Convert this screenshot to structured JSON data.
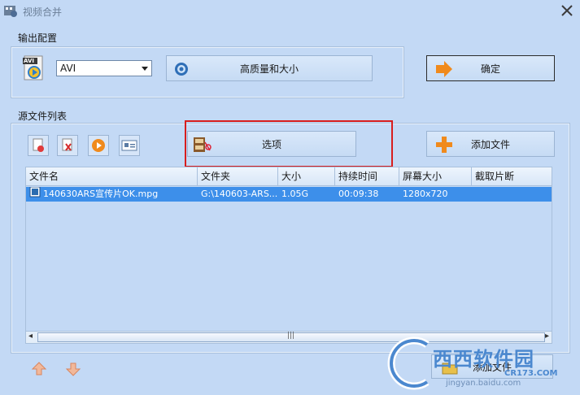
{
  "window": {
    "title": "视频合并"
  },
  "output_config": {
    "label": "输出配置",
    "format_value": "AVI",
    "format_badge": "AVI",
    "quality_button": "高质量和大小",
    "ok_button": "确定"
  },
  "source_files": {
    "label": "源文件列表",
    "options_button": "选项",
    "add_file_button": "添加文件",
    "columns": [
      "文件名",
      "文件夹",
      "大小",
      "持续时间",
      "屏幕大小",
      "截取片断"
    ],
    "rows": [
      {
        "name": "140630ARS宣传片OK.mpg",
        "folder": "G:\\140603-ARS...",
        "size": "1.05G",
        "duration": "00:09:38",
        "screen": "1280x720",
        "clip": ""
      }
    ]
  },
  "scrollbar": {
    "left_arrow": "◂",
    "right_arrow": "▸",
    "grip": "|||"
  },
  "bottom": {
    "partial_button_text": "添加文件"
  },
  "watermark": {
    "line1": "西西软件园",
    "line2": "jingyan.baidu.com",
    "line3": "CR173.COM"
  },
  "colors": {
    "window_bg": "#c3d9f5",
    "selection": "#3d8fea",
    "highlight_box": "#d81e1e",
    "accent_orange": "#f08a1c"
  },
  "icons": {
    "title": "video-merge-icon",
    "close": "close-icon",
    "avi": "avi-file-icon",
    "quality": "gear-icon",
    "ok": "arrow-right-icon",
    "options": "film-scissors-icon",
    "add": "plus-icon",
    "up": "arrow-up-icon",
    "down": "arrow-down-icon"
  }
}
